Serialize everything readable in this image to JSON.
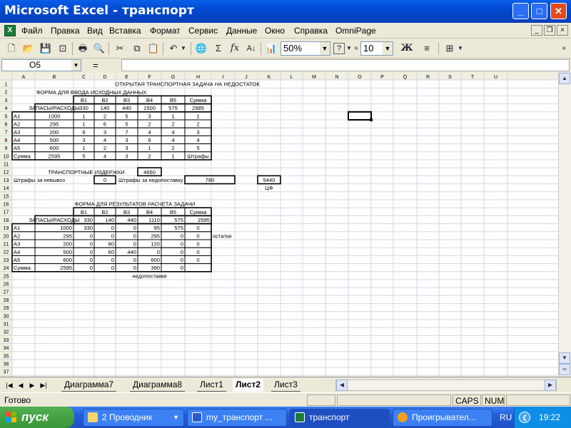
{
  "window": {
    "title": "Microsoft Excel - транспорт",
    "min": "_",
    "max": "□",
    "close": "✕"
  },
  "menu": {
    "icon": "excel-doc-icon",
    "items": [
      "Файл",
      "Правка",
      "Вид",
      "Вставка",
      "Формат",
      "Сервис",
      "Данные",
      "Окно",
      "Справка",
      "OmniPage"
    ],
    "doc_min": "_",
    "doc_max": "❐",
    "doc_close": "×"
  },
  "toolbar": {
    "zoom": "50%",
    "font_size": "10",
    "bold": "Ж",
    "help": "?"
  },
  "formula": {
    "name_box": "O5",
    "eq": "=",
    "value": ""
  },
  "grid": {
    "columns": [
      "A",
      "B",
      "C",
      "D",
      "E",
      "F",
      "G",
      "H",
      "I",
      "J",
      "K",
      "L",
      "M",
      "N",
      "O",
      "P",
      "Q",
      "R",
      "S",
      "T",
      "U"
    ],
    "rows": [
      "1",
      "2",
      "3",
      "4",
      "5",
      "6",
      "7",
      "8",
      "9",
      "10",
      "11",
      "12",
      "13",
      "14",
      "15",
      "16",
      "17",
      "18",
      "19",
      "20",
      "21",
      "22",
      "23",
      "24",
      "25",
      "26",
      "27",
      "28",
      "29",
      "30",
      "31",
      "32",
      "33",
      "34",
      "35",
      "36",
      "37"
    ],
    "selected": "O5"
  },
  "sheet": {
    "title": "ОТКРЫТАЯ ТРАНСПОРТНАЯ ЗАДАЧА НА НЕДОСТАТОК",
    "input_title": "ФОРМА ДЛЯ ВВОДА ИСХОДНЫХ ДАННЫХ",
    "hdr_b": [
      "В1",
      "В2",
      "В3",
      "В4",
      "В5",
      "Сумма"
    ],
    "label": "ЗАПАСЫ/РАСХОДЫ",
    "demand": [
      "330",
      "140",
      "440",
      "1500",
      "575",
      "2985"
    ],
    "in_rows": [
      [
        "А1",
        "1000",
        "1",
        "2",
        "5",
        "3",
        "1",
        "1"
      ],
      [
        "А2",
        "295",
        "1",
        "6",
        "5",
        "2",
        "2",
        "2"
      ],
      [
        "А3",
        "200",
        "6",
        "3",
        "7",
        "4",
        "4",
        "3"
      ],
      [
        "А4",
        "500",
        "3",
        "4",
        "3",
        "6",
        "4",
        "4"
      ],
      [
        "А5",
        "600",
        "1",
        "2",
        "3",
        "1",
        "2",
        "5"
      ],
      [
        "Сумма",
        "2595",
        "5",
        "4",
        "3",
        "2",
        "1",
        "Штрафы"
      ]
    ],
    "cost_label": "ТРАНСПОРТНЫЕ ИЗДЕРЖКИ",
    "cost": "4660",
    "pen1_label": "Штрафы за невывоз",
    "pen1": "0",
    "pen2_label": "Штрафы за недопоставку",
    "pen2": "780",
    "total": "5440",
    "cf": "ЦФ",
    "result_title": "ФОРМА ДЛЯ РЕЗУЛЬТАТОВ РАСЧЕТА ЗАДАЧИ",
    "res_demand": [
      "330",
      "140",
      "440",
      "1110",
      "575",
      "2595"
    ],
    "res_rows": [
      [
        "А1",
        "1000",
        "330",
        "0",
        "0",
        "95",
        "575",
        "0"
      ],
      [
        "А2",
        "295",
        "0",
        "0",
        "0",
        "295",
        "0",
        "0"
      ],
      [
        "А3",
        "200",
        "0",
        "80",
        "0",
        "120",
        "0",
        "0"
      ],
      [
        "А4",
        "500",
        "0",
        "60",
        "440",
        "0",
        "0",
        "0"
      ],
      [
        "А5",
        "600",
        "0",
        "0",
        "0",
        "600",
        "0",
        "0"
      ],
      [
        "Сумма",
        "2595",
        "0",
        "0",
        "0",
        "390",
        "0",
        ""
      ]
    ],
    "ostatki": "остатки",
    "nedopostavki": "недопоставки"
  },
  "tabs": [
    "Диаграмма7",
    "Диаграмма8",
    "Лист1",
    "Лист2",
    "Лист3"
  ],
  "active_tab": "Лист2",
  "status": {
    "ready": "Готово",
    "caps": "CAPS",
    "num": "NUM"
  },
  "taskbar": {
    "start": "пуск",
    "tasks": [
      "2 Проводник",
      "my_транспорт ...",
      "транспорт",
      "Проигрывател..."
    ],
    "lang": "RU",
    "time": "19:22"
  }
}
